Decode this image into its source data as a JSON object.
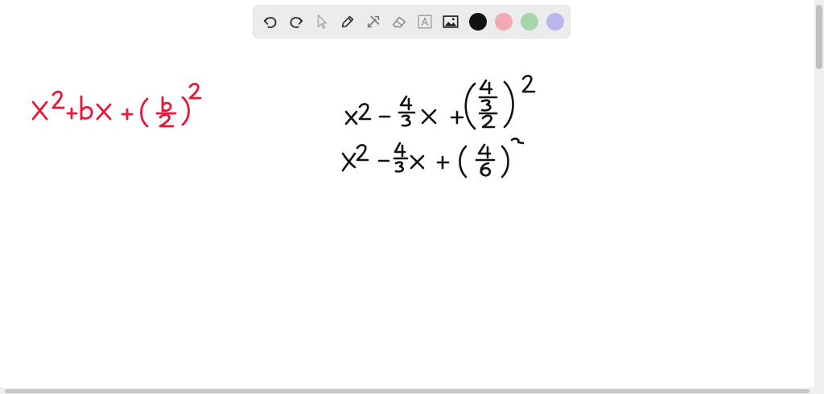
{
  "toolbar": {
    "tools": [
      {
        "name": "undo-icon"
      },
      {
        "name": "redo-icon"
      },
      {
        "name": "select-pointer-icon"
      },
      {
        "name": "pen-icon"
      },
      {
        "name": "tools-icon"
      },
      {
        "name": "eraser-icon"
      },
      {
        "name": "text-icon"
      },
      {
        "name": "image-icon"
      }
    ],
    "colors": {
      "black": "#111111",
      "red": "#f1a9b4",
      "green": "#a8d5a8",
      "purple": "#b9b7ec"
    }
  },
  "ink_colors": {
    "red": "#e8173a",
    "black": "#111111"
  }
}
